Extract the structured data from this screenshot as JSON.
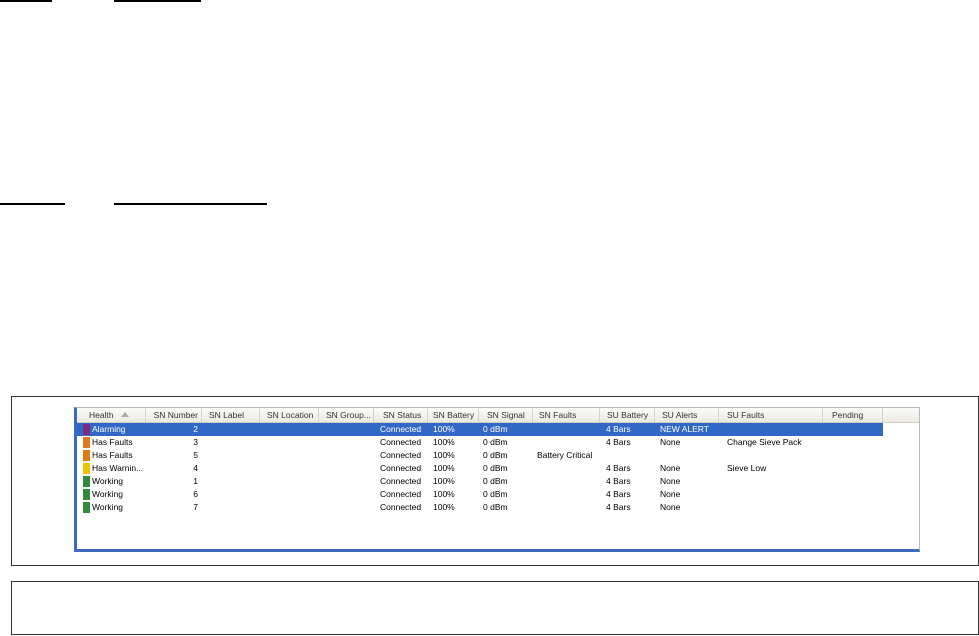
{
  "columns": [
    {
      "label": "Health"
    },
    {
      "label": "SN Number"
    },
    {
      "label": "SN Label"
    },
    {
      "label": "SN Location"
    },
    {
      "label": "SN Group..."
    },
    {
      "label": "SN Status"
    },
    {
      "label": "SN Battery"
    },
    {
      "label": "SN Signal"
    },
    {
      "label": "SN Faults"
    },
    {
      "label": "SU Battery"
    },
    {
      "label": "SU Alerts"
    },
    {
      "label": "SU Faults"
    },
    {
      "label": "Pending"
    }
  ],
  "sort": {
    "column": "Health",
    "direction": "ascending",
    "icon": "sort-ascending-icon"
  },
  "colors": {
    "alarming": "#7b2b84",
    "has_faults": "#e07a19",
    "has_warning": "#f2c200",
    "working": "#2f8a3a",
    "selection": "#3168c6"
  },
  "rows": [
    {
      "icon": "alarming",
      "health": "Alarming",
      "sn_number": "2",
      "sn_label": "",
      "sn_location": "",
      "sn_group": "",
      "sn_status": "Connected",
      "sn_battery": "100%",
      "sn_signal": "0 dBm",
      "sn_faults": "",
      "su_battery": "4 Bars",
      "su_alerts": "NEW ALERT",
      "su_faults": "",
      "pending": "",
      "selected": true
    },
    {
      "icon": "has_faults",
      "health": "Has Faults",
      "sn_number": "3",
      "sn_label": "",
      "sn_location": "",
      "sn_group": "",
      "sn_status": "Connected",
      "sn_battery": "100%",
      "sn_signal": "0 dBm",
      "sn_faults": "",
      "su_battery": "4 Bars",
      "su_alerts": "None",
      "su_faults": "Change Sieve Pack",
      "pending": ""
    },
    {
      "icon": "has_faults",
      "health": "Has Faults",
      "sn_number": "5",
      "sn_label": "",
      "sn_location": "",
      "sn_group": "",
      "sn_status": "Connected",
      "sn_battery": "100%",
      "sn_signal": "0 dBm",
      "sn_faults": "Battery Critical",
      "su_battery": "",
      "su_alerts": "",
      "su_faults": "",
      "pending": ""
    },
    {
      "icon": "has_warning",
      "health": "Has Warnin...",
      "sn_number": "4",
      "sn_label": "",
      "sn_location": "",
      "sn_group": "",
      "sn_status": "Connected",
      "sn_battery": "100%",
      "sn_signal": "0 dBm",
      "sn_faults": "",
      "su_battery": "4 Bars",
      "su_alerts": "None",
      "su_faults": "Sieve Low",
      "pending": ""
    },
    {
      "icon": "working",
      "health": "Working",
      "sn_number": "1",
      "sn_label": "",
      "sn_location": "",
      "sn_group": "",
      "sn_status": "Connected",
      "sn_battery": "100%",
      "sn_signal": "0 dBm",
      "sn_faults": "",
      "su_battery": "4 Bars",
      "su_alerts": "None",
      "su_faults": "",
      "pending": ""
    },
    {
      "icon": "working",
      "health": "Working",
      "sn_number": "6",
      "sn_label": "",
      "sn_location": "",
      "sn_group": "",
      "sn_status": "Connected",
      "sn_battery": "100%",
      "sn_signal": "0 dBm",
      "sn_faults": "",
      "su_battery": "4 Bars",
      "su_alerts": "None",
      "su_faults": "",
      "pending": ""
    },
    {
      "icon": "working",
      "health": "Working",
      "sn_number": "7",
      "sn_label": "",
      "sn_location": "",
      "sn_group": "",
      "sn_status": "Connected",
      "sn_battery": "100%",
      "sn_signal": "0 dBm",
      "sn_faults": "",
      "su_battery": "4 Bars",
      "su_alerts": "None",
      "su_faults": "",
      "pending": ""
    }
  ]
}
